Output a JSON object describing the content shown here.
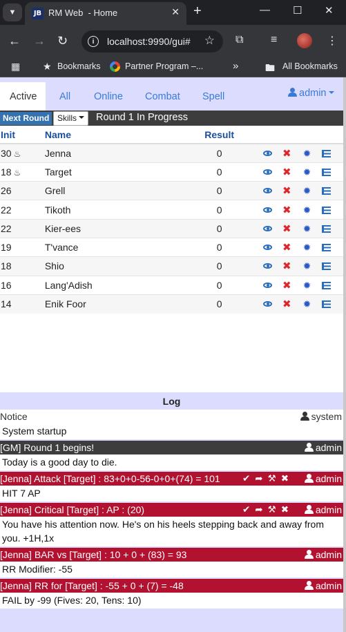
{
  "browser": {
    "tab_favicon": "JB",
    "tab_title": "RM Web  - Home",
    "url": "localhost:9990/gui#",
    "bookmarks": [
      "Bookmarks",
      "Partner Program –...",
      "All Bookmarks"
    ],
    "overflow": "»"
  },
  "tabs": [
    "Active",
    "All",
    "Online",
    "Combat",
    "Spell"
  ],
  "user_menu": "admin",
  "roundbar": {
    "next_round": "Next Round",
    "skills": "Skills",
    "status": "Round 1 In Progress"
  },
  "table": {
    "headers": [
      "Init",
      "Name",
      "Result"
    ],
    "rows": [
      {
        "init": "30",
        "flame": true,
        "name": "Jenna",
        "result": "0"
      },
      {
        "init": "18",
        "flame": true,
        "name": "Target",
        "result": "0"
      },
      {
        "init": "26",
        "flame": false,
        "name": "Grell",
        "result": "0"
      },
      {
        "init": "22",
        "flame": false,
        "name": "Tikoth",
        "result": "0"
      },
      {
        "init": "22",
        "flame": false,
        "name": "Kier-ees",
        "result": "0"
      },
      {
        "init": "19",
        "flame": false,
        "name": "T'vance",
        "result": "0"
      },
      {
        "init": "18",
        "flame": false,
        "name": "Shio",
        "result": "0"
      },
      {
        "init": "16",
        "flame": false,
        "name": "Lang'Adish",
        "result": "0"
      },
      {
        "init": "14",
        "flame": false,
        "name": "Enik Foor",
        "result": "0"
      }
    ]
  },
  "log": {
    "title": "Log",
    "entries": [
      {
        "style": "notice",
        "head": "Notice",
        "user": "system",
        "tools": false,
        "body": "System startup"
      },
      {
        "style": "gm",
        "head": "[GM] Round 1 begins!",
        "user": "admin",
        "tools": false,
        "body": "Today is a good day to die."
      },
      {
        "style": "atk",
        "head": "[Jenna] Attack [Target] : 83+0+0-56-0+0+(74) = 101",
        "user": "admin",
        "tools": true,
        "body": "HIT 7 AP"
      },
      {
        "style": "atk",
        "head": "[Jenna] Critical [Target] : AP : (20)",
        "user": "admin",
        "tools": true,
        "body": "You have his attention now. He's on his heels stepping back and away from you. +1H,1x"
      },
      {
        "style": "atk",
        "head": "[Jenna] BAR vs [Target] : 10 + 0 + (83) = 93",
        "user": "admin",
        "tools": false,
        "body": "RR Modifier: -55"
      },
      {
        "style": "atk",
        "head": "[Jenna] RR for [Target] : -55 + 0 + (7) = -48",
        "user": "admin",
        "tools": false,
        "body": "FAIL by -99 (Fives: 20, Tens: 10)"
      }
    ]
  },
  "colors": {
    "tab_bar": "#dcdcff",
    "round_bar": "#3d3d3d",
    "attack_header": "#b21230",
    "link": "#3a7bd5"
  },
  "icons": {
    "row_actions": [
      "eye-icon",
      "remove-icon",
      "burst-icon",
      "list-icon"
    ],
    "log_tools": [
      "check-icon",
      "share-icon",
      "wrench-icon",
      "close-icon"
    ]
  }
}
